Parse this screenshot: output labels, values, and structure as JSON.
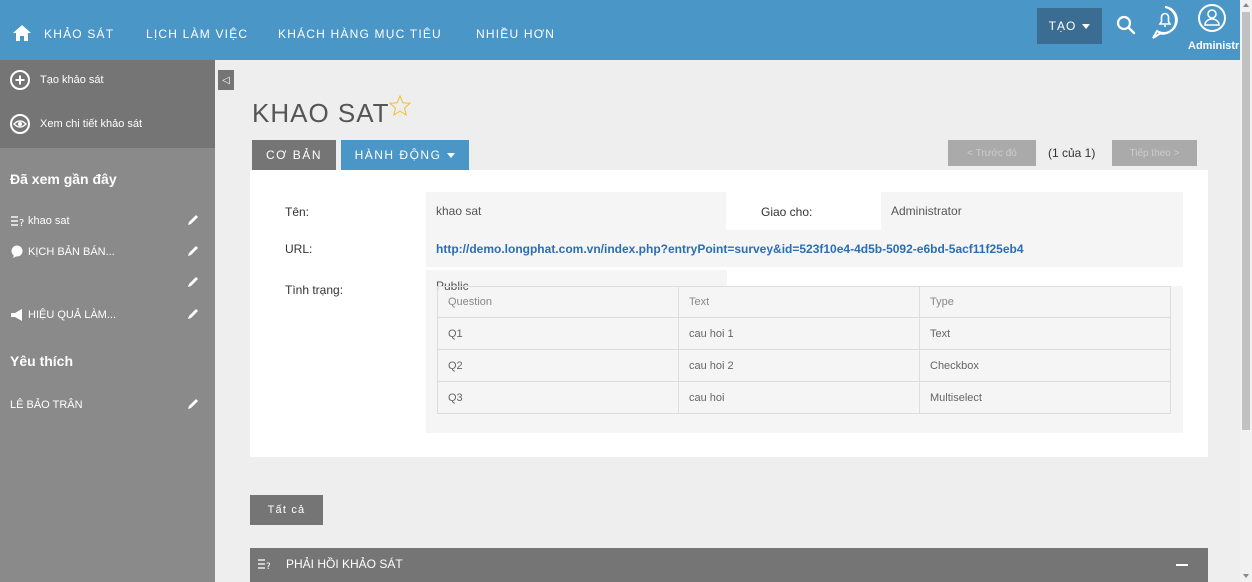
{
  "nav": {
    "items": [
      "KHẢO SÁT",
      "LỊCH LÀM VIỆC",
      "KHÁCH HÀNG MỤC TIÊU",
      "NHIỀU HƠN"
    ],
    "create_label": "TẠO",
    "user_label": "Administr",
    "icons": [
      "home-icon",
      "search-icon",
      "notification-icon",
      "user-icon"
    ]
  },
  "sidebar": {
    "actions": [
      "Tạo khảo sát",
      "Xem chi tiết khảo sát"
    ],
    "recent_heading": "Đã xem gần đây",
    "recent_items": [
      "khao sat",
      "KỊCH BẢN BÁN...",
      "",
      "HIỆU QUẢ LÀM..."
    ],
    "favorites_heading": "Yêu thích",
    "favorite_items": [
      "LÊ BẢO TRÂN"
    ]
  },
  "main": {
    "title": "KHAO SAT",
    "tabs": [
      "CƠ BẢN",
      "HÀNH ĐỘNG"
    ],
    "pagination": {
      "prev": "< Trước đó",
      "count": "(1 của 1)",
      "next": "Tiếp theo >"
    },
    "fields": {
      "name_label": "Tên:",
      "name_value": "khao sat",
      "assigned_label": "Giao cho:",
      "assigned_value": "Administrator",
      "url_label": "URL:",
      "url_value": "http://demo.longphat.com.vn/index.php?entryPoint=survey&id=523f10e4-4d5b-5092-e6bd-5acf11f25eb4",
      "status_label": "Tình trạng:",
      "status_value": "Public"
    },
    "questions": {
      "headers": [
        "Question",
        "Text",
        "Type"
      ],
      "rows": [
        [
          "Q1",
          "cau hoi 1",
          "Text"
        ],
        [
          "Q2",
          "cau hoi 2",
          "Checkbox"
        ],
        [
          "Q3",
          "cau hoi",
          "Multiselect"
        ]
      ]
    },
    "all_button": "Tất cả",
    "section_header": "PHẢI HỒI KHẢO SÁT"
  },
  "colors": {
    "accent": "#4a96c6",
    "sidebar": "#8a8a8a",
    "button_dark": "#757575"
  }
}
